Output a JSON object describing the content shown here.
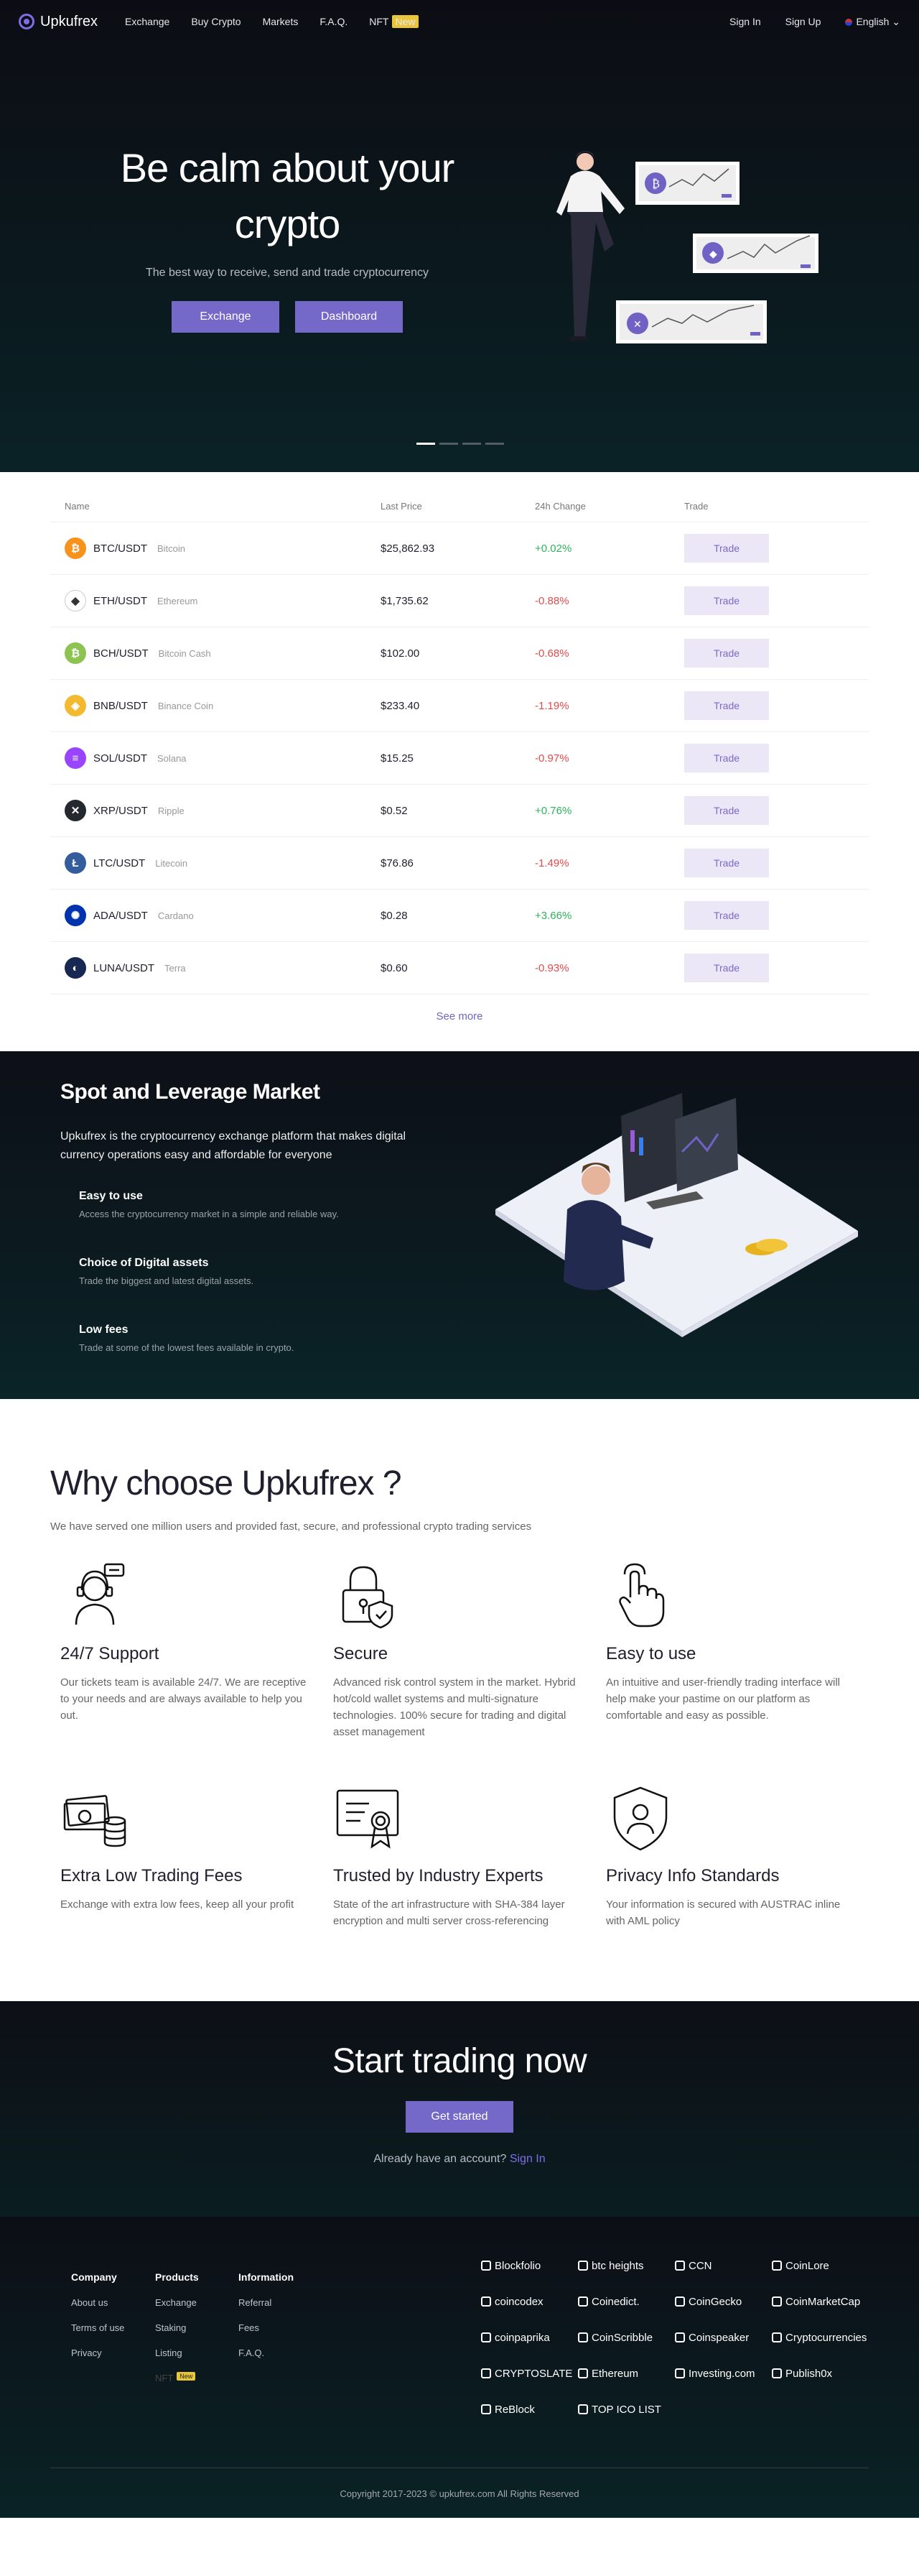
{
  "nav": {
    "brand": "Upkufrex",
    "links": [
      "Exchange",
      "Buy Crypto",
      "Markets",
      "F.A.Q.",
      "NFT"
    ],
    "nft_badge": "New",
    "sign_in": "Sign In",
    "sign_up": "Sign Up",
    "language": "English"
  },
  "hero": {
    "title": "Be calm about your crypto",
    "subtitle": "The best way to receive, send and trade cryptocurrency",
    "exchange_button": "Exchange",
    "dashboard_button": "Dashboard"
  },
  "markets": {
    "headers": [
      "Name",
      "Last Price",
      "24h Change",
      "Trade"
    ],
    "rows": [
      {
        "pair": "BTC/USDT",
        "name": "Bitcoin",
        "price": "$25,862.93",
        "change": "+0.02%",
        "trend": "up",
        "color": "#f7931a",
        "icon": "bitcoin-icon"
      },
      {
        "pair": "ETH/USDT",
        "name": "Ethereum",
        "price": "$1,735.62",
        "change": "-0.88%",
        "trend": "down",
        "color": "#ffffff",
        "icon": "ethereum-icon"
      },
      {
        "pair": "BCH/USDT",
        "name": "Bitcoin Cash",
        "price": "$102.00",
        "change": "-0.68%",
        "trend": "down",
        "color": "#8dc351",
        "icon": "bitcoin-cash-icon"
      },
      {
        "pair": "BNB/USDT",
        "name": "Binance Coin",
        "price": "$233.40",
        "change": "-1.19%",
        "trend": "down",
        "color": "#f3ba2f",
        "icon": "binance-icon"
      },
      {
        "pair": "SOL/USDT",
        "name": "Solana",
        "price": "$15.25",
        "change": "-0.97%",
        "trend": "down",
        "color": "#9945ff",
        "icon": "solana-icon"
      },
      {
        "pair": "XRP/USDT",
        "name": "Ripple",
        "price": "$0.52",
        "change": "+0.76%",
        "trend": "up",
        "color": "#23292f",
        "icon": "ripple-icon"
      },
      {
        "pair": "LTC/USDT",
        "name": "Litecoin",
        "price": "$76.86",
        "change": "-1.49%",
        "trend": "down",
        "color": "#345d9d",
        "icon": "litecoin-icon"
      },
      {
        "pair": "ADA/USDT",
        "name": "Cardano",
        "price": "$0.28",
        "change": "+3.66%",
        "trend": "up",
        "color": "#0033ad",
        "icon": "cardano-icon"
      },
      {
        "pair": "LUNA/USDT",
        "name": "Terra",
        "price": "$0.60",
        "change": "-0.93%",
        "trend": "down",
        "color": "#172852",
        "icon": "terra-icon"
      }
    ],
    "trade_label": "Trade",
    "see_more": "See more"
  },
  "spot": {
    "title": "Spot and Leverage Market",
    "description": "Upkufrex is the cryptocurrency exchange platform that makes digital currency operations easy and affordable for everyone",
    "features": [
      {
        "title": "Easy to use",
        "text": "Access the cryptocurrency market in a simple and reliable way."
      },
      {
        "title": "Choice of Digital assets",
        "text": "Trade the biggest and latest digital assets."
      },
      {
        "title": "Low fees",
        "text": "Trade at some of the lowest fees available in crypto."
      }
    ]
  },
  "why": {
    "title": "Why choose Upkufrex ?",
    "subtitle": "We have served one million users and provided fast, secure, and professional crypto trading services",
    "items": [
      {
        "title": "24/7 Support",
        "text": "Our tickets team is available 24/7. We are receptive to your needs and are always available to help you out.",
        "icon": "support-agent-icon"
      },
      {
        "title": "Secure",
        "text": "Advanced risk control system in the market. Hybrid hot/cold wallet systems and multi-signature technologies. 100% secure for trading and digital asset management",
        "icon": "lock-shield-icon"
      },
      {
        "title": "Easy to use",
        "text": "An intuitive and user-friendly trading interface will help make your pastime on our platform as comfortable and easy as possible.",
        "icon": "touch-hand-icon"
      },
      {
        "title": "Extra Low Trading Fees",
        "text": "Exchange with extra low fees, keep all your profit",
        "icon": "money-coins-icon"
      },
      {
        "title": "Trusted by Industry Experts",
        "text": "State of the art infrastructure with SHA-384 layer encryption and multi server cross-referencing",
        "icon": "certificate-icon"
      },
      {
        "title": "Privacy Info Standards",
        "text": "Your information is secured with AUSTRAC inline with AML policy",
        "icon": "privacy-shield-icon"
      }
    ]
  },
  "cta": {
    "title": "Start trading now",
    "button": "Get started",
    "account_text": "Already have an account?",
    "sign_in": "Sign In"
  },
  "footer": {
    "company": {
      "title": "Company",
      "links": [
        "About us",
        "Terms of use",
        "Privacy"
      ]
    },
    "products": {
      "title": "Products",
      "links": [
        "Exchange",
        "Staking",
        "Listing",
        "NFT"
      ],
      "nft_badge": "New"
    },
    "information": {
      "title": "Information",
      "links": [
        "Referral",
        "Fees",
        "F.A.Q."
      ]
    },
    "partners": [
      "Blockfolio",
      "btc heights",
      "CCN",
      "CoinLore",
      "coincodex",
      "Coinedict.",
      "CoinGecko",
      "CoinMarketCap",
      "coinpaprika",
      "CoinScribble",
      "Coinspeaker",
      "Cryptocurrencies",
      "CRYPTOSLATE",
      "Ethereum",
      "Investing.com",
      "Publish0x",
      "ReBlock",
      "TOP ICO LIST"
    ],
    "copyright": "Copyright 2017-2023 © upkufrex.com All Rights Reserved"
  },
  "colors": {
    "accent": "#7469c9",
    "up": "#2fb25c",
    "down": "#e14b4b"
  }
}
